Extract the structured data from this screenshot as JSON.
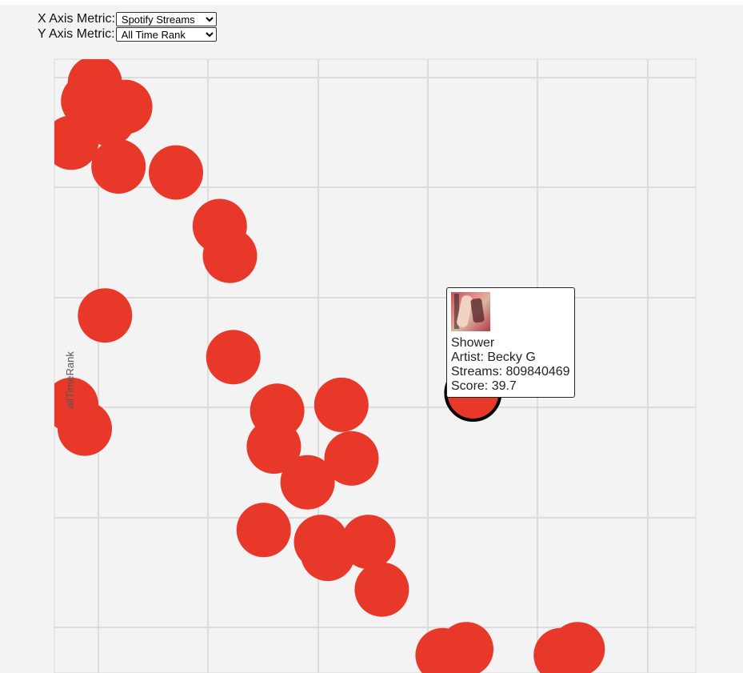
{
  "controls": {
    "x_label": "X Axis Metric:",
    "x_selected": "Spotify Streams",
    "y_label": "Y Axis Metric:",
    "y_selected": "All Time Rank"
  },
  "chart_data": {
    "type": "scatter",
    "title": "",
    "xlabel": "",
    "ylabel": "allTimeRank",
    "grid": true,
    "marker_color": "#e8382a",
    "highlight_stroke": "#000000",
    "background": "#f3f3f3",
    "points": [
      {
        "x": 0.5,
        "y": 7.0
      },
      {
        "x": 0.52,
        "y": 7.3
      },
      {
        "x": 0.56,
        "y": 6.7
      },
      {
        "x": 0.61,
        "y": 6.9
      },
      {
        "x": 0.45,
        "y": 6.3
      },
      {
        "x": 0.59,
        "y": 5.9
      },
      {
        "x": 0.76,
        "y": 5.8
      },
      {
        "x": 0.92,
        "y": 4.4
      },
      {
        "x": 0.89,
        "y": 4.9
      },
      {
        "x": 0.55,
        "y": 3.4
      },
      {
        "x": 0.93,
        "y": 2.7
      },
      {
        "x": 0.45,
        "y": 1.9
      },
      {
        "x": 0.49,
        "y": 1.5
      },
      {
        "x": 1.06,
        "y": 1.8
      },
      {
        "x": 1.05,
        "y": 1.2
      },
      {
        "x": 1.25,
        "y": 1.9
      },
      {
        "x": 1.28,
        "y": 1.0
      },
      {
        "x": 1.15,
        "y": 0.6
      },
      {
        "x": 1.02,
        "y": -0.2
      },
      {
        "x": 1.21,
        "y": -0.6
      },
      {
        "x": 1.19,
        "y": -0.4
      },
      {
        "x": 1.33,
        "y": -0.4
      },
      {
        "x": 1.37,
        "y": -1.2
      },
      {
        "x": 1.55,
        "y": -2.3
      },
      {
        "x": 1.62,
        "y": -2.2
      },
      {
        "x": 1.95,
        "y": -2.2
      },
      {
        "x": 1.9,
        "y": -2.3
      },
      {
        "x": 1.64,
        "y": 2.1,
        "highlight": true
      }
    ],
    "xlim": [
      0.4,
      2.3
    ],
    "ylim": [
      -2.6,
      7.7
    ]
  },
  "tooltip": {
    "song": "Shower",
    "artist": "Artist: Becky G",
    "streams": "Streams: 809840469",
    "score": "Score: 39.7"
  }
}
